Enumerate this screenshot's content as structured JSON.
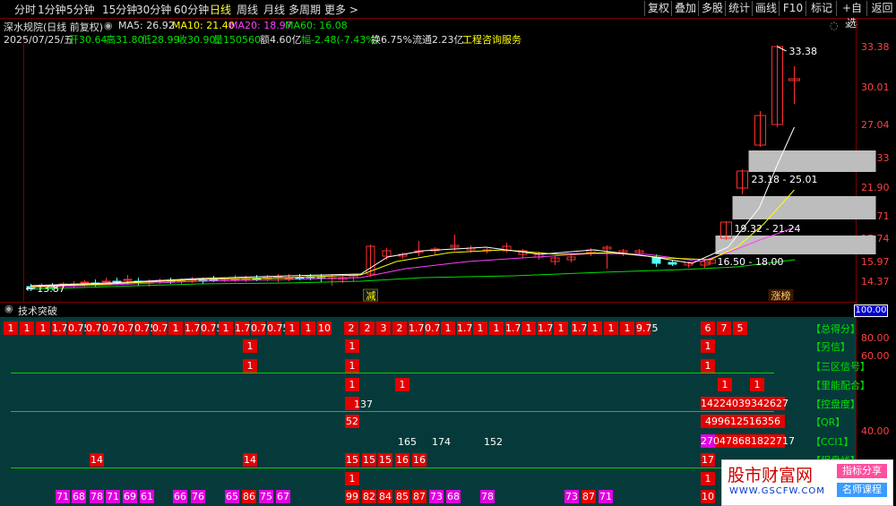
{
  "toolbar": {
    "periods": [
      "分时",
      "1分钟",
      "5分钟",
      "15分钟",
      "30分钟",
      "60分钟",
      "日线",
      "周线",
      "月线",
      "多周期",
      "更多 >"
    ],
    "active_index": 6,
    "right_buttons": [
      "复权",
      "叠加",
      "多股",
      "统计",
      "画线",
      "F10",
      "标记",
      "+自选",
      "返回"
    ]
  },
  "info": {
    "stock_name": "深水规院(日线 前复权)",
    "ma5": "MA5: 26.92",
    "ma10": "MA10: 21.40",
    "ma20": "MA20: 18.97",
    "ma60": "MA60: 16.08",
    "date": "2025/07/25/五",
    "open": "开30.64",
    "high": "高31.80",
    "low": "低28.99",
    "close": "收30.90",
    "volume": "量150560",
    "amount": "额4.60亿",
    "change": "幅-2.48(-7.43%)",
    "turnover": "换6.75%",
    "float": "流通2.23亿",
    "service": "工程咨询服务"
  },
  "price_axis": [
    "33.38",
    "30.01",
    "27.04",
    "24.33",
    "21.90",
    "19.71",
    "17.74",
    "15.97",
    "14.37"
  ],
  "chart_labels": {
    "high_price": "33.38",
    "low_price": "13.87",
    "zone1": "23.18 - 25.01",
    "zone2": "19.32 - 21.24",
    "zone3": "16.50 - 18.00",
    "tag_reduce": "减",
    "tag_limit": "涨榜"
  },
  "indicator": {
    "title": "技术突破",
    "axis": [
      "100.00",
      "80.00",
      "60.00",
      "40.00"
    ],
    "labels": [
      "【总得分】",
      "【另信】",
      "【三区信号】",
      "【里能配合】",
      "【控盘度】",
      "【QR】",
      "【CCI1】",
      "【程盘线】"
    ],
    "row1": [
      "1",
      "1",
      "1",
      "1.75",
      "0.75",
      "0.75",
      "0.75",
      "0.75",
      "0.75",
      "0.75",
      "1",
      "1.75",
      "0.75",
      "1",
      "1.75",
      "0.75",
      "0.75",
      "1",
      "1",
      "10",
      "2",
      "2",
      "3",
      "2",
      "1.75",
      "0.75",
      "1",
      "1.75",
      "1",
      "1",
      "1.75",
      "1",
      "1.75",
      "1",
      "1.75",
      "1",
      "1",
      "1",
      "9.75",
      "6",
      "7",
      "5"
    ],
    "row5_text": "137",
    "row5_right": "14224039342627",
    "row6_text": "52",
    "row6_right": [
      "49",
      "96",
      "125",
      "16",
      "35",
      "6"
    ],
    "row7_nums": [
      "165",
      "174",
      "152"
    ],
    "row7_right": [
      "27",
      "04",
      "78",
      "68",
      "18",
      "22",
      "71",
      "7"
    ],
    "row8": [
      "14",
      "14",
      "15",
      "15",
      "15",
      "16",
      "16",
      "17"
    ],
    "row9": [
      "1",
      "1"
    ],
    "row10_mag": [
      "71",
      "68",
      "78",
      "71",
      "69",
      "61",
      "66",
      "76",
      "65",
      "75",
      "67",
      "85",
      "73",
      "68",
      "78",
      "73",
      "87",
      "71"
    ],
    "row10_red": [
      "86",
      "99",
      "82",
      "84",
      "87",
      "10"
    ]
  },
  "watermark": {
    "title": "股市财富网",
    "url": "WWW.GSCFW.COM",
    "tag1": "指标分享",
    "tag2": "名师课程"
  },
  "colors": {
    "up": "#ff3030",
    "down": "#54ffff",
    "ma5": "#ffffff",
    "ma10": "#ffff00",
    "ma20": "#ff40ff",
    "ma60": "#00e000"
  }
}
